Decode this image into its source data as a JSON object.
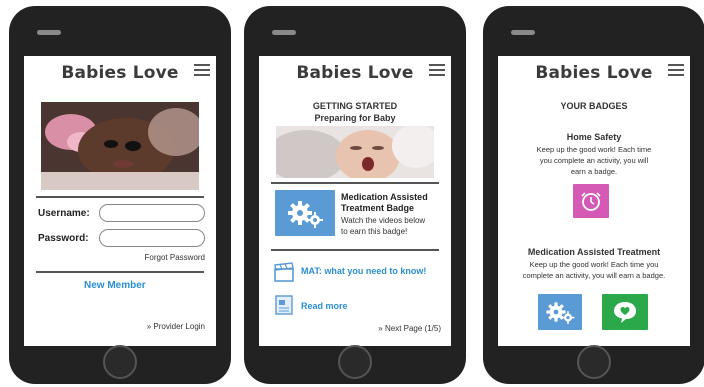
{
  "app": {
    "title": "Babies Love"
  },
  "screen1": {
    "username_label": "Username:",
    "password_label": "Password:",
    "username_value": "",
    "password_value": "",
    "forgot_password": "Forgot Password",
    "new_member": "New Member",
    "provider_login": "» Provider Login"
  },
  "screen2": {
    "heading": "GETTING STARTED",
    "subheading": "Preparing for Baby",
    "badge_title_1": "Medication Assisted",
    "badge_title_2": "Treatment Badge",
    "badge_desc_1": "Watch the videos below",
    "badge_desc_2": "to earn this badge!",
    "video_link": "MAT: what you need to know!",
    "read_link": "Read more",
    "next_page": "» Next Page (1/5)"
  },
  "screen3": {
    "heading": "YOUR BADGES",
    "home_safety_title": "Home Safety",
    "home_safety_desc_1": "Keep up the good work! Each time",
    "home_safety_desc_2": "you complete an activity, you will",
    "home_safety_desc_3": "earn a badge.",
    "mat_title": "Medication Assisted Treatment",
    "mat_desc_1": "Keep up the good work! Each time you",
    "mat_desc_2": "complete an activity, you will earn a badge."
  },
  "colors": {
    "link_blue": "#2c8fcf",
    "badge_blue": "#5b9bd5",
    "badge_pink": "#d45ab5",
    "badge_green": "#2ba84a",
    "phone_body": "#222222"
  },
  "icons": {
    "menu": "hamburger-menu-icon",
    "gears": "gears-icon",
    "clapperboard": "clapperboard-icon",
    "document": "document-icon",
    "clock": "clock-icon",
    "heart_chat": "heart-speech-bubble-icon"
  }
}
